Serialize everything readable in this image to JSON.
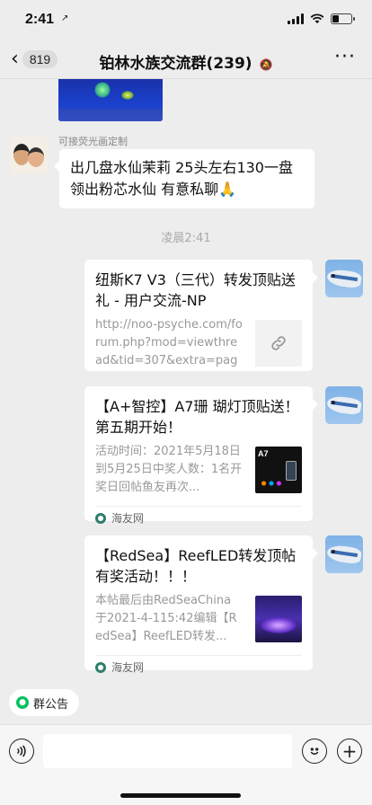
{
  "status_bar": {
    "time": "2:41",
    "location_arrow": "↗",
    "battery_level": 0.3
  },
  "header": {
    "back_icon": "chevron-left-icon",
    "unread_count": "819",
    "title": "铂林水族交流群(239)",
    "mute_icon": "bell-slash-icon",
    "more_icon": "more-icon"
  },
  "messages": [
    {
      "sender": "可接荧光画定制",
      "text": "出几盘水仙茉莉 25头左右130一盘 领出粉芯水仙 有意私聊🙏"
    }
  ],
  "time_separator": "凌晨2:41",
  "cards": [
    {
      "title": "纽斯K7 V3（三代）转发顶贴送礼 - 用户交流-NP",
      "desc": "http://noo-psyche.com/forum.php?mod=viewthread&tid=307&extra=page...",
      "thumb": "link-icon"
    },
    {
      "title": "【A+智控】A7珊 瑚灯顶贴送！第五期开始！",
      "desc": "活动时间：2021年5月18日到5月25日中奖人数：1名开奖日回帖鱼友再次...",
      "thumb_label": "A7",
      "source": "海友网"
    },
    {
      "title": "【RedSea】ReefLED转发顶帖有奖活动！！！",
      "desc": "本帖最后由RedSeaChina于2021-4-115:42编辑【RedSea】ReefLED转发...",
      "source": "海友网"
    }
  ],
  "bottom": {
    "announcement": "群公告",
    "voice_icon": "voice-icon",
    "emoji_icon": "emoji-icon",
    "plus_icon": "plus-icon"
  }
}
